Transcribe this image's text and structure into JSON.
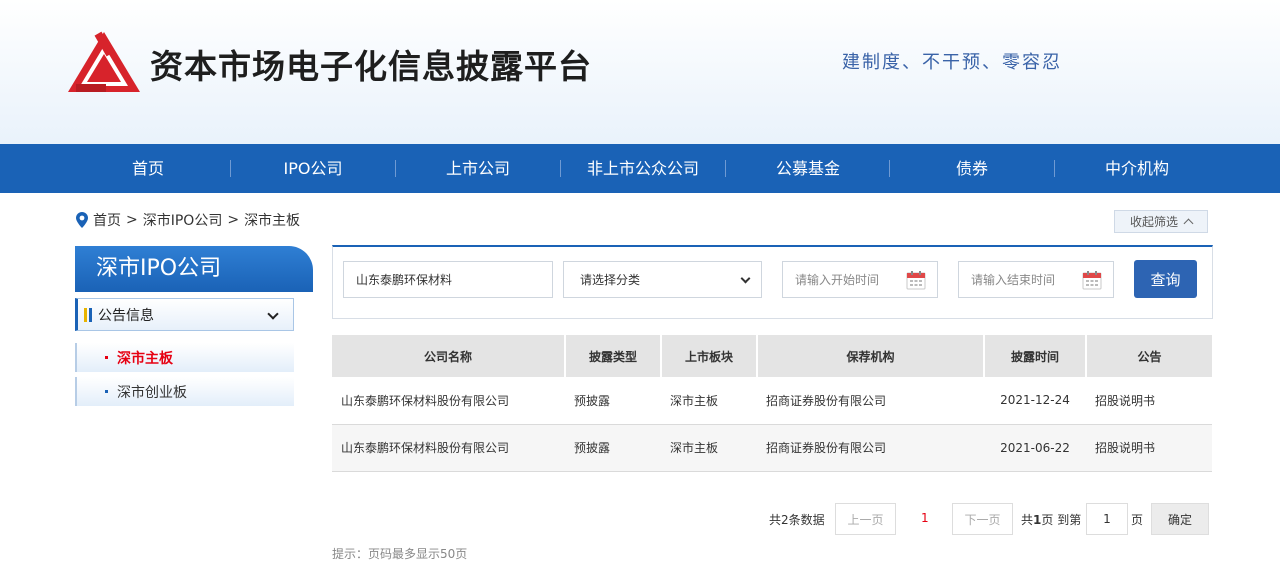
{
  "header": {
    "site_title": "资本市场电子化信息披露平台",
    "slogan": "建制度、不干预、零容忍"
  },
  "nav": {
    "items": [
      "首页",
      "IPO公司",
      "上市公司",
      "非上市公众公司",
      "公募基金",
      "债券",
      "中介机构"
    ]
  },
  "breadcrumb": {
    "home": "首页",
    "sep": ">",
    "level1": "深市IPO公司",
    "level2": "深市主板"
  },
  "collapse_label": "收起筛选",
  "sidebar": {
    "title": "深市IPO公司",
    "group_label": "公告信息",
    "items": [
      {
        "label": "深市主板",
        "active": true
      },
      {
        "label": "深市创业板",
        "active": false
      }
    ]
  },
  "filter": {
    "company_value": "山东泰鹏环保材料",
    "category_placeholder": "请选择分类",
    "start_placeholder": "请输入开始时间",
    "end_placeholder": "请输入结束时间",
    "query_label": "查询"
  },
  "table": {
    "headers": [
      "公司名称",
      "披露类型",
      "上市板块",
      "保荐机构",
      "披露时间",
      "公告"
    ],
    "rows": [
      [
        "山东泰鹏环保材料股份有限公司",
        "预披露",
        "深市主板",
        "招商证券股份有限公司",
        "2021-12-24",
        "招股说明书"
      ],
      [
        "山东泰鹏环保材料股份有限公司",
        "预披露",
        "深市主板",
        "招商证券股份有限公司",
        "2021-06-22",
        "招股说明书"
      ]
    ]
  },
  "pagination": {
    "total_text": "共2条数据",
    "prev_label": "上一页",
    "current_page": "1",
    "next_label": "下一页",
    "pages_text_prefix": "共",
    "pages_count": "1",
    "pages_text_suffix": "页 到第",
    "goto_value": "1",
    "page_unit": "页",
    "confirm_label": "确定"
  },
  "hint": "提示：页码最多显示50页",
  "colors": {
    "brand_blue": "#1a62b6",
    "accent_red": "#e60012",
    "logo_red": "#d7232b"
  }
}
